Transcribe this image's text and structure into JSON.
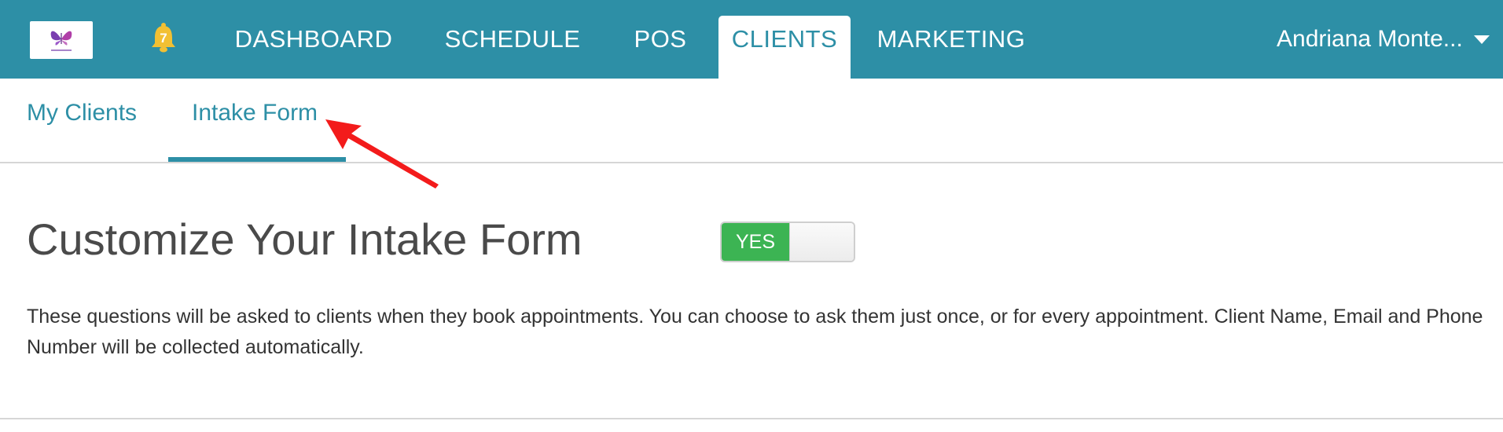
{
  "header": {
    "notifications_count": "7",
    "nav": [
      {
        "label": "DASHBOARD"
      },
      {
        "label": "SCHEDULE"
      },
      {
        "label": "POS"
      },
      {
        "label": "CLIENTS",
        "active": true
      },
      {
        "label": "MARKETING"
      }
    ],
    "user_name": "Andriana Monte..."
  },
  "subnav": {
    "tabs": [
      {
        "label": "My Clients"
      },
      {
        "label": "Intake Form",
        "active": true
      }
    ]
  },
  "main": {
    "title": "Customize Your Intake Form",
    "toggle_label": "YES",
    "toggle_on": true,
    "description": "These questions will be asked to clients when they book appointments. You can choose to ask them just once, or for every appointment. Client Name, Email and Phone Number will be collected automatically."
  },
  "colors": {
    "brand_teal": "#2d8fa6",
    "toggle_green": "#3cb453",
    "annotation_red": "#f31b1b",
    "bell_yellow": "#f2c033"
  },
  "icons": {
    "logo": "butterfly-logo",
    "notifications": "bell-icon",
    "user_menu": "chevron-down-icon",
    "annotation": "red-arrow-icon"
  }
}
